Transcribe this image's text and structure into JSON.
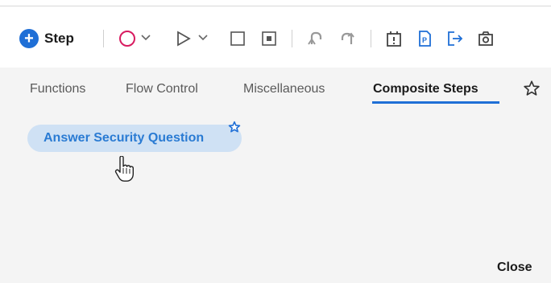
{
  "toolbar": {
    "step_label": "Step",
    "step_plus": "+",
    "icons": [
      "record-icon",
      "dropdown-chevron-icon",
      "play-icon",
      "dropdown-chevron-icon",
      "stop-icon",
      "pause-icon",
      "undo-icon",
      "redo-icon",
      "breakpoint-icon",
      "parameter-icon",
      "export-icon",
      "screenshot-icon"
    ]
  },
  "tabs": {
    "items": [
      {
        "label": "Functions"
      },
      {
        "label": "Flow Control"
      },
      {
        "label": "Miscellaneous"
      },
      {
        "label": "Composite Steps"
      }
    ],
    "active": "Composite Steps"
  },
  "composite": {
    "item_label": "Answer Security Question"
  },
  "footer": {
    "close_label": "Close"
  },
  "colors": {
    "accent": "#1f6fd6",
    "record": "#d81b60",
    "chip_bg": "#cfe1f4",
    "chip_text": "#2a7bd3"
  }
}
